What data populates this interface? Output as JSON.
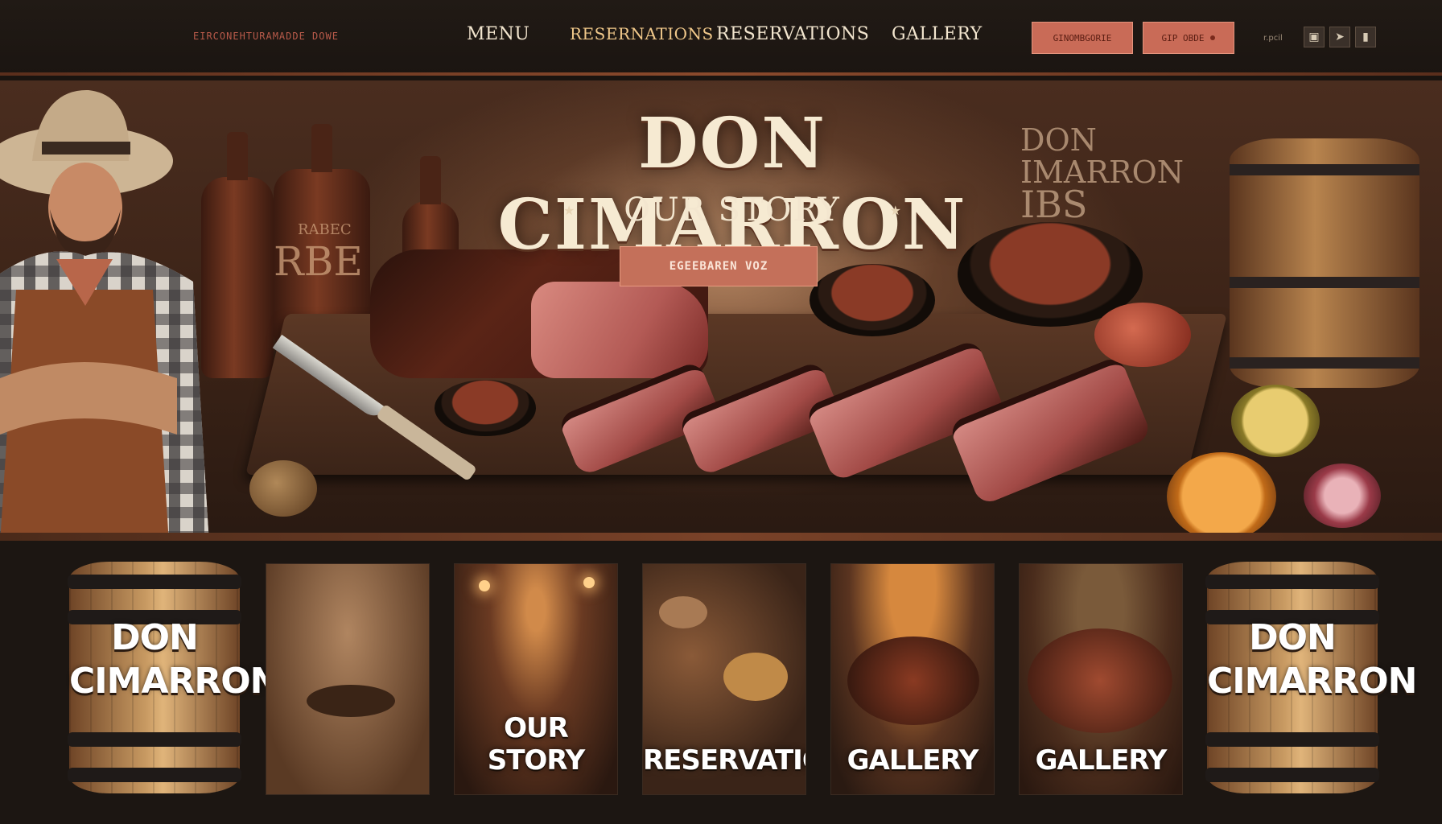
{
  "nav": {
    "brand_strip": "EIRCONEHTURAMADDE   DOWE",
    "items": [
      "MENU",
      "RESERNATIONS",
      "RESERVATIONS",
      "GALLERY"
    ],
    "button_1": "GINOMBGORIE",
    "button_2": "GIP OBDE",
    "small_text": "r.pcil",
    "icons": [
      "camera-icon",
      "send-icon",
      "phone-icon"
    ]
  },
  "hero": {
    "title": "DON CIMARRON",
    "subtitle": "OUR STORY",
    "cta": "EGEEBAREN VOZ",
    "side_text_1": "DON",
    "side_text_2": "IMARRON",
    "side_text_3": "IBS",
    "bottle_text": "RBE",
    "bottle_text_small": "RABEC"
  },
  "cards": {
    "barrel_left": [
      "DON",
      "CIMARRON"
    ],
    "barrel_right": [
      "DON",
      "CIMARRON"
    ],
    "items": [
      {
        "label": ""
      },
      {
        "label": "OUR STORY"
      },
      {
        "label": "RESERVATIONS"
      },
      {
        "label": "GALLERY"
      },
      {
        "label": "GALLERY"
      }
    ]
  },
  "colors": {
    "background": "#1a1410",
    "accent": "#c96b57",
    "text": "#f3e6cf",
    "nav_alt": "#f0c88a"
  }
}
